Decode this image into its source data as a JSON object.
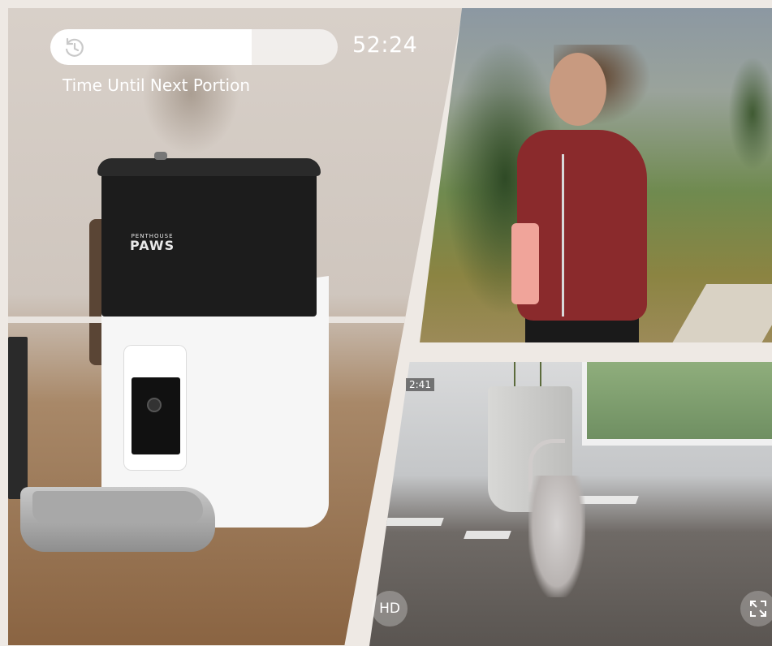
{
  "product": {
    "brand_line1": "PENTHOUSE",
    "brand_line2": "PAWS"
  },
  "timer": {
    "value": "52:24",
    "caption": "Time Until Next Portion",
    "progress_fraction": 0.7,
    "icon": "history-icon"
  },
  "camera": {
    "timestamp": "2:41",
    "hd_label": "HD",
    "fullscreen_icon": "expand-icon"
  },
  "colors": {
    "timer_text": "#ffffff",
    "feeder_top": "#1c1c1c",
    "feeder_body": "#f6f6f6"
  }
}
